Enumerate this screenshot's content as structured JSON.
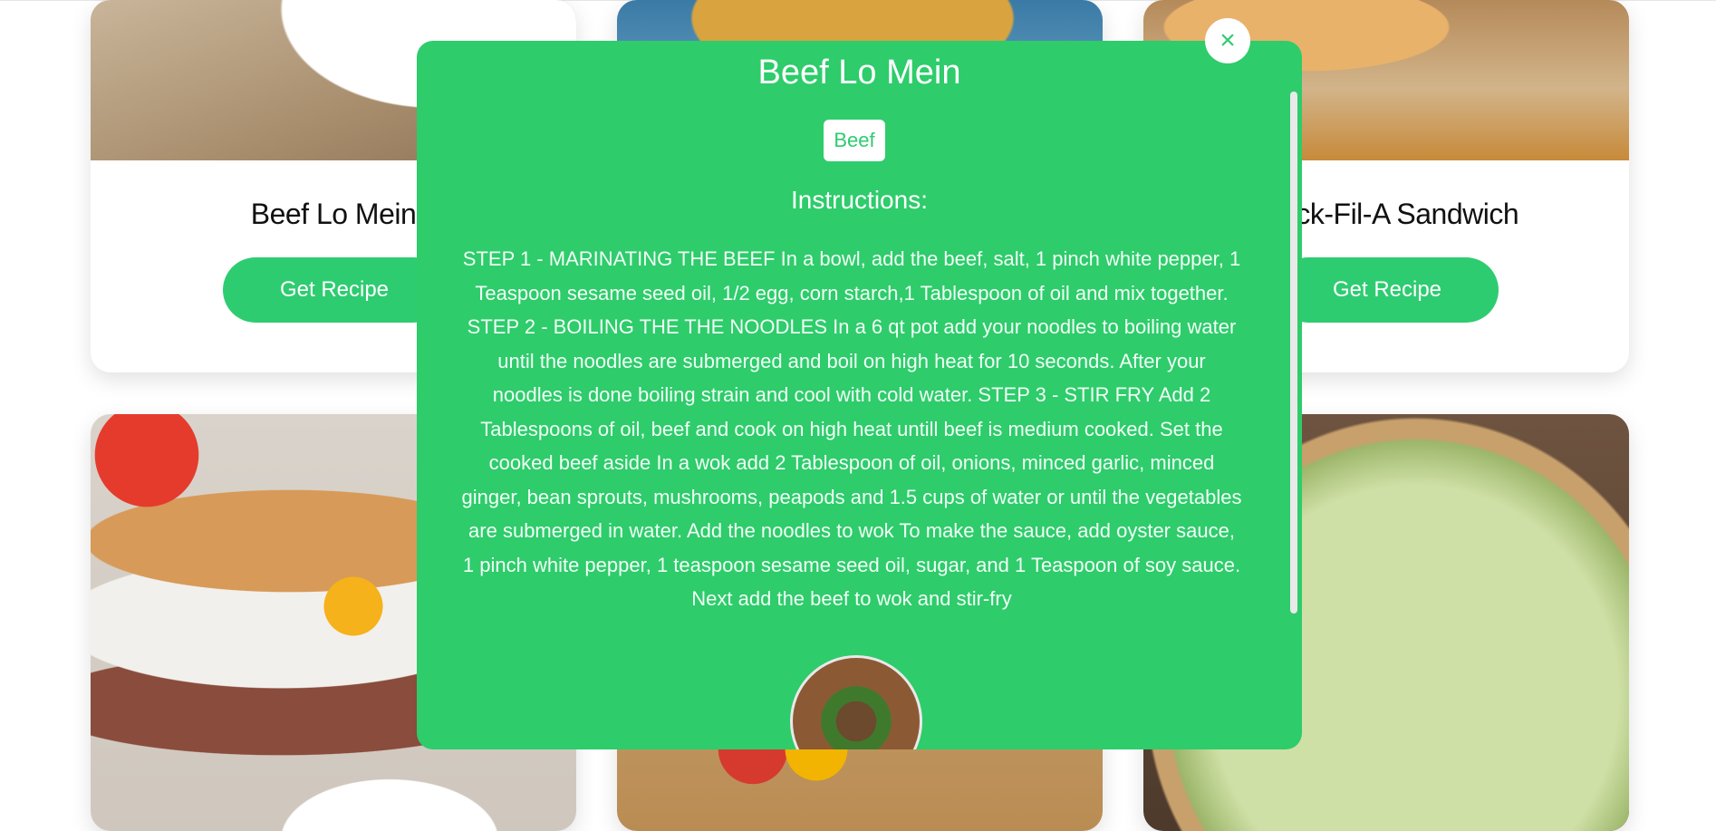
{
  "cards": [
    {
      "title": "Beef Lo Mein",
      "button_label": "Get Recipe"
    },
    {
      "title": "",
      "button_label": ""
    },
    {
      "title": "Chick-Fil-A Sandwich",
      "button_label": "Get Recipe"
    }
  ],
  "modal": {
    "title": "Beef Lo Mein",
    "tag": "Beef",
    "instructions_heading": "Instructions:",
    "instructions": "STEP 1 - MARINATING THE BEEF In a bowl, add the beef, salt, 1 pinch white pepper, 1 Teaspoon sesame seed oil, 1/2 egg, corn starch,1 Tablespoon of oil and mix together. STEP 2 - BOILING THE THE NOODLES In a 6 qt pot add your noodles to boiling water until the noodles are submerged and boil on high heat for 10 seconds. After your noodles is done boiling strain and cool with cold water. STEP 3 - STIR FRY Add 2 Tablespoons of oil, beef and cook on high heat untill beef is medium cooked. Set the cooked beef aside In a wok add 2 Tablespoon of oil, onions, minced garlic, minced ginger, bean sprouts, mushrooms, peapods and 1.5 cups of water or until the vegetables are submerged in water. Add the noodles to wok To make the sauce, add oyster sauce, 1 pinch white pepper, 1 teaspoon sesame seed oil, sugar, and 1 Teaspoon of soy sauce. Next add the beef to wok and stir-fry",
    "close_icon": "close-icon"
  },
  "colors": {
    "accent": "#2ecc71",
    "modal_bg": "#2ecc6b"
  }
}
